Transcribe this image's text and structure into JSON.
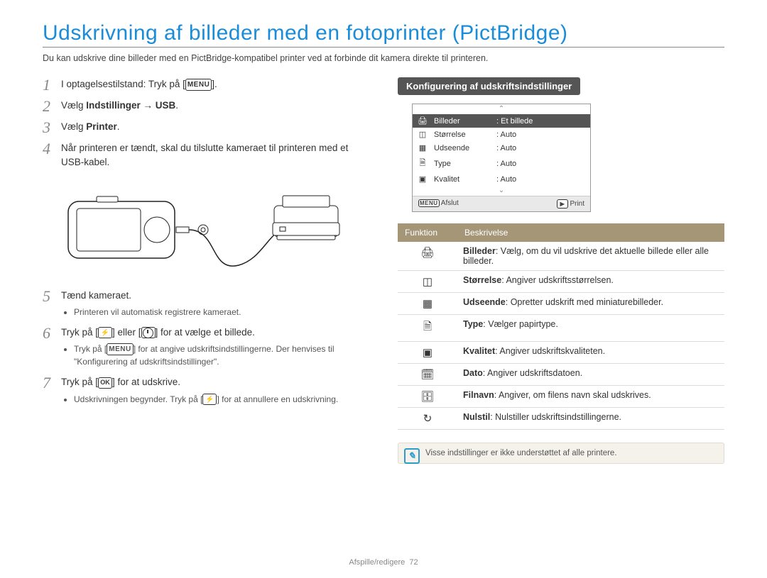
{
  "title": "Udskrivning af billeder med en fotoprinter (PictBridge)",
  "intro": "Du kan udskrive dine billeder med en PictBridge-kompatibel printer ved at forbinde dit kamera direkte til printeren.",
  "icons": {
    "menu": "MENU",
    "ok": "OK",
    "flash": "⯈",
    "play": "▶",
    "reset": "↻"
  },
  "steps": {
    "s1_a": "I optagelsestilstand: Tryk på [",
    "s1_b": "].",
    "s2_a": "Vælg ",
    "s2_b": "Indstillinger → USB",
    "s2_c": ".",
    "s3_a": "Vælg ",
    "s3_b": "Printer",
    "s3_c": ".",
    "s4": "Når printeren er tændt, skal du tilslutte kameraet til printeren med et USB-kabel.",
    "s5": "Tænd kameraet.",
    "s5_sub": "Printeren vil automatisk registrere kameraet.",
    "s6_a": "Tryk på [",
    "s6_b": "] eller [",
    "s6_c": "] for at vælge et billede.",
    "s6_sub_a": "Tryk på [",
    "s6_sub_b": "] for at angive udskriftsindstillingerne. Der henvises til \"Konfigurering af udskriftsindstillinger\".",
    "s7_a": "Tryk på [",
    "s7_b": "] for at udskrive.",
    "s7_sub_a": "Udskrivningen begynder. Tryk på [",
    "s7_sub_b": "] for at annullere en udskrivning."
  },
  "section_head": "Konfigurering af udskriftsindstillinger",
  "lcd": {
    "rows": [
      {
        "icon": "🖨",
        "name": "Billeder",
        "value": "Et billede",
        "selected": true
      },
      {
        "icon": "◫",
        "name": "Størrelse",
        "value": "Auto"
      },
      {
        "icon": "▦",
        "name": "Udseende",
        "value": "Auto"
      },
      {
        "icon": "🗎",
        "name": "Type",
        "value": "Auto"
      },
      {
        "icon": "▣",
        "name": "Kvalitet",
        "value": "Auto"
      }
    ],
    "menu_label": "Afslut",
    "play_label": "Print"
  },
  "table": {
    "head_func": "Funktion",
    "head_desc": "Beskrivelse",
    "rows": [
      {
        "icon": "🖨",
        "term": "Billeder",
        "desc": ": Vælg, om du vil udskrive det aktuelle billede eller alle billeder."
      },
      {
        "icon": "◫",
        "term": "Størrelse",
        "desc": ": Angiver udskriftsstørrelsen."
      },
      {
        "icon": "▦",
        "term": "Udseende",
        "desc": ": Opretter udskrift med miniaturebilleder."
      },
      {
        "icon": "🗎",
        "term": "Type",
        "desc": ": Vælger papirtype."
      },
      {
        "icon": "▣",
        "term": "Kvalitet",
        "desc": ": Angiver udskriftskvaliteten."
      },
      {
        "icon": "🗓",
        "term": "Dato",
        "desc": ": Angiver udskriftsdatoen."
      },
      {
        "icon": "🗄",
        "term": "Filnavn",
        "desc": ": Angiver, om filens navn skal udskrives."
      },
      {
        "icon": "↻",
        "term": "Nulstil",
        "desc": ": Nulstiller udskriftsindstillingerne."
      }
    ]
  },
  "note": "Visse indstillinger er ikke understøttet af alle printere.",
  "footer_section": "Afspille/redigere",
  "footer_page": "72"
}
